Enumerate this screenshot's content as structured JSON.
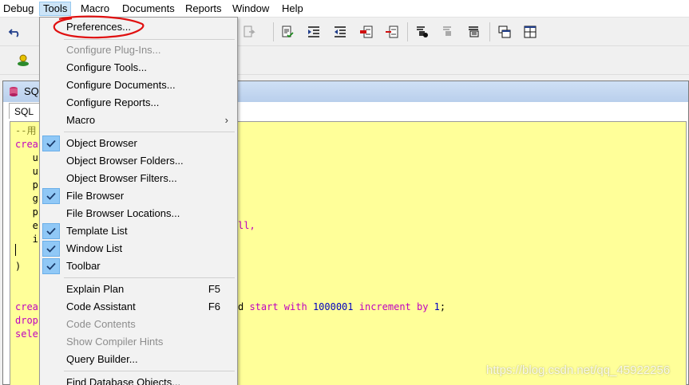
{
  "menubar": {
    "items": [
      "Debug",
      "Tools",
      "Macro",
      "Documents",
      "Reports",
      "Window",
      "Help"
    ]
  },
  "sql_window": {
    "title": "SQ",
    "tab": "SQL"
  },
  "editor": {
    "lines": [
      {
        "t": "--用"
      },
      {
        "t": "crea"
      },
      {
        "t": "   u"
      },
      {
        "t": "   u"
      },
      {
        "t": "   p"
      },
      {
        "t": "   g"
      },
      {
        "t": "   p"
      },
      {
        "t": "   e"
      },
      {
        "t": "   i"
      },
      {
        "t": ")"
      },
      {
        "t": "crea"
      },
      {
        "t": "drop"
      },
      {
        "t": "sele"
      }
    ],
    "fragment_ll": "ll,",
    "fragment_seq_d": "d ",
    "fragment_start_with": "start with ",
    "fragment_start_value": "1000001",
    "fragment_increment_by": " increment by ",
    "fragment_increment_value": "1",
    "fragment_end": ";"
  },
  "tools_menu": {
    "items": [
      {
        "label": "Preferences...",
        "shortcut": "",
        "checked": false,
        "disabled": false,
        "submenu": false
      },
      {
        "label": "Configure Plug-Ins...",
        "shortcut": "",
        "checked": false,
        "disabled": true,
        "submenu": false
      },
      {
        "label": "Configure Tools...",
        "shortcut": "",
        "checked": false,
        "disabled": false,
        "submenu": false
      },
      {
        "label": "Configure Documents...",
        "shortcut": "",
        "checked": false,
        "disabled": false,
        "submenu": false
      },
      {
        "label": "Configure Reports...",
        "shortcut": "",
        "checked": false,
        "disabled": false,
        "submenu": false
      },
      {
        "label": "Macro",
        "shortcut": "",
        "checked": false,
        "disabled": false,
        "submenu": true
      },
      {
        "label": "Object Browser",
        "shortcut": "",
        "checked": true,
        "disabled": false,
        "submenu": false
      },
      {
        "label": "Object Browser Folders...",
        "shortcut": "",
        "checked": false,
        "disabled": false,
        "submenu": false
      },
      {
        "label": "Object Browser Filters...",
        "shortcut": "",
        "checked": false,
        "disabled": false,
        "submenu": false
      },
      {
        "label": "File Browser",
        "shortcut": "",
        "checked": true,
        "disabled": false,
        "submenu": false
      },
      {
        "label": "File Browser Locations...",
        "shortcut": "",
        "checked": false,
        "disabled": false,
        "submenu": false
      },
      {
        "label": "Template List",
        "shortcut": "",
        "checked": true,
        "disabled": false,
        "submenu": false
      },
      {
        "label": "Window List",
        "shortcut": "",
        "checked": true,
        "disabled": false,
        "submenu": false
      },
      {
        "label": "Toolbar",
        "shortcut": "",
        "checked": true,
        "disabled": false,
        "submenu": false
      },
      {
        "label": "Explain Plan",
        "shortcut": "F5",
        "checked": false,
        "disabled": false,
        "submenu": false
      },
      {
        "label": "Code Assistant",
        "shortcut": "F6",
        "checked": false,
        "disabled": false,
        "submenu": false
      },
      {
        "label": "Code Contents",
        "shortcut": "",
        "checked": false,
        "disabled": true,
        "submenu": false
      },
      {
        "label": "Show Compiler Hints",
        "shortcut": "",
        "checked": false,
        "disabled": true,
        "submenu": false
      },
      {
        "label": "Query Builder...",
        "shortcut": "",
        "checked": false,
        "disabled": false,
        "submenu": false
      },
      {
        "label": "Find Database Objects...",
        "shortcut": "",
        "checked": false,
        "disabled": false,
        "submenu": false
      }
    ],
    "submenu_arrow": "›"
  },
  "watermark": "https://blog.csdn.net/qq_45922256",
  "colors": {
    "editor_bg": "#ffff99",
    "keyword": "#c000c0",
    "number": "#0000c0",
    "check_bg": "#90c8f6",
    "annotation_red": "#e01010"
  }
}
